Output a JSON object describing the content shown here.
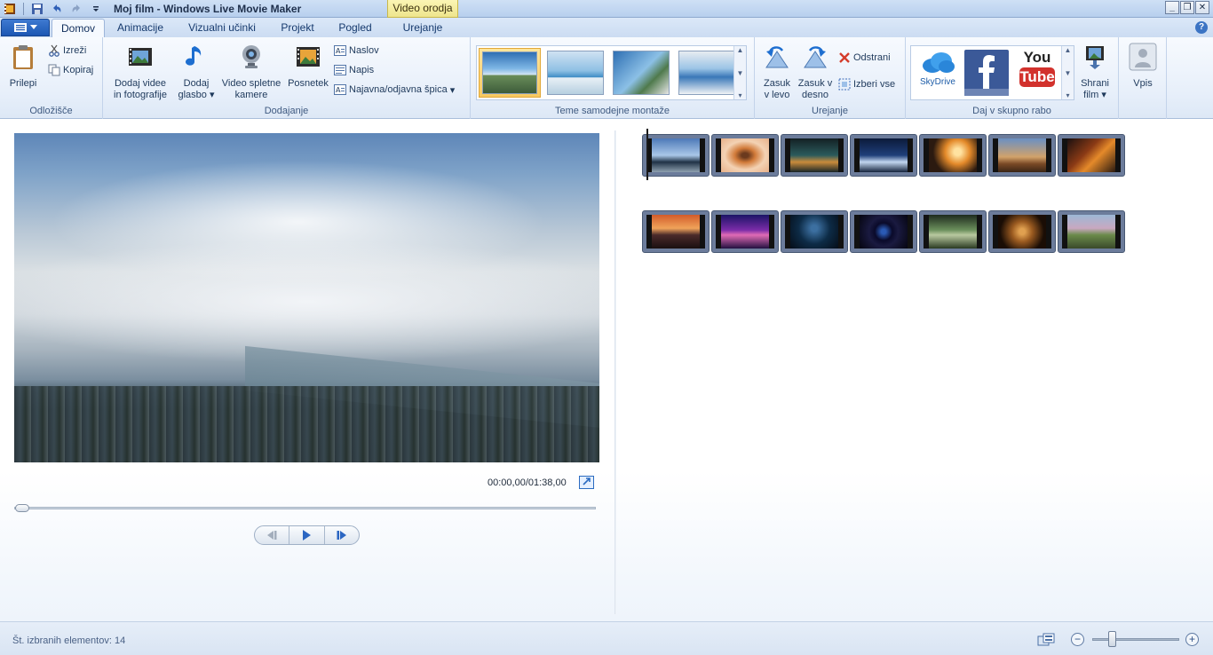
{
  "window": {
    "title": "Moj film - Windows Live Movie Maker",
    "context_tab": "Video orodja",
    "controls": [
      "_",
      "❐",
      "✕"
    ]
  },
  "tabs": [
    {
      "label": "Domov",
      "active": true
    },
    {
      "label": "Animacije"
    },
    {
      "label": "Vizualni učinki"
    },
    {
      "label": "Projekt"
    },
    {
      "label": "Pogled"
    },
    {
      "label": "Urejanje"
    }
  ],
  "ribbon": {
    "clipboard": {
      "label": "Odložišče",
      "paste": "Prilepi",
      "cut": "Izreži",
      "copy": "Kopiraj"
    },
    "add": {
      "label": "Dodajanje",
      "add_videos_line1": "Dodaj videe",
      "add_videos_line2": "in fotografije",
      "add_music_line1": "Dodaj",
      "add_music_line2": "glasbo",
      "webcam_line1": "Video spletne",
      "webcam_line2": "kamere",
      "snapshot": "Posnetek",
      "title": "Naslov",
      "caption": "Napis",
      "credits": "Najavna/odjavna špica"
    },
    "themes": {
      "label": "Teme samodejne montaže"
    },
    "editing": {
      "label": "Urejanje",
      "rotate_left_line1": "Zasuk",
      "rotate_left_line2": "v levo",
      "rotate_right_line1": "Zasuk v",
      "rotate_right_line2": "desno",
      "remove": "Odstrani",
      "select_all": "Izberi vse"
    },
    "share": {
      "label": "Daj v skupno rabo",
      "skydrive": "SkyDrive",
      "youtube_line1": "You",
      "youtube_line2": "Tube",
      "save_movie_line1": "Shrani",
      "save_movie_line2": "film"
    },
    "signin": {
      "label": "Vpis"
    }
  },
  "preview": {
    "timecode": "00:00,00/01:38,00",
    "seek_position": 0.0
  },
  "storyboard": {
    "rows": [
      [
        "clip-1",
        "clip-2",
        "clip-3",
        "clip-4",
        "clip-5",
        "clip-6",
        "clip-7"
      ],
      [
        "clip-8",
        "clip-9",
        "clip-10",
        "clip-11",
        "clip-12",
        "clip-13",
        "clip-14"
      ]
    ]
  },
  "status": {
    "selected_items": "Št. izbranih elementov: 14",
    "zoom_level": 0.2
  },
  "colors": {
    "accent": "#2b66c2",
    "ribbon_bg": "#e7effa",
    "selected_theme": "#f8c960"
  }
}
